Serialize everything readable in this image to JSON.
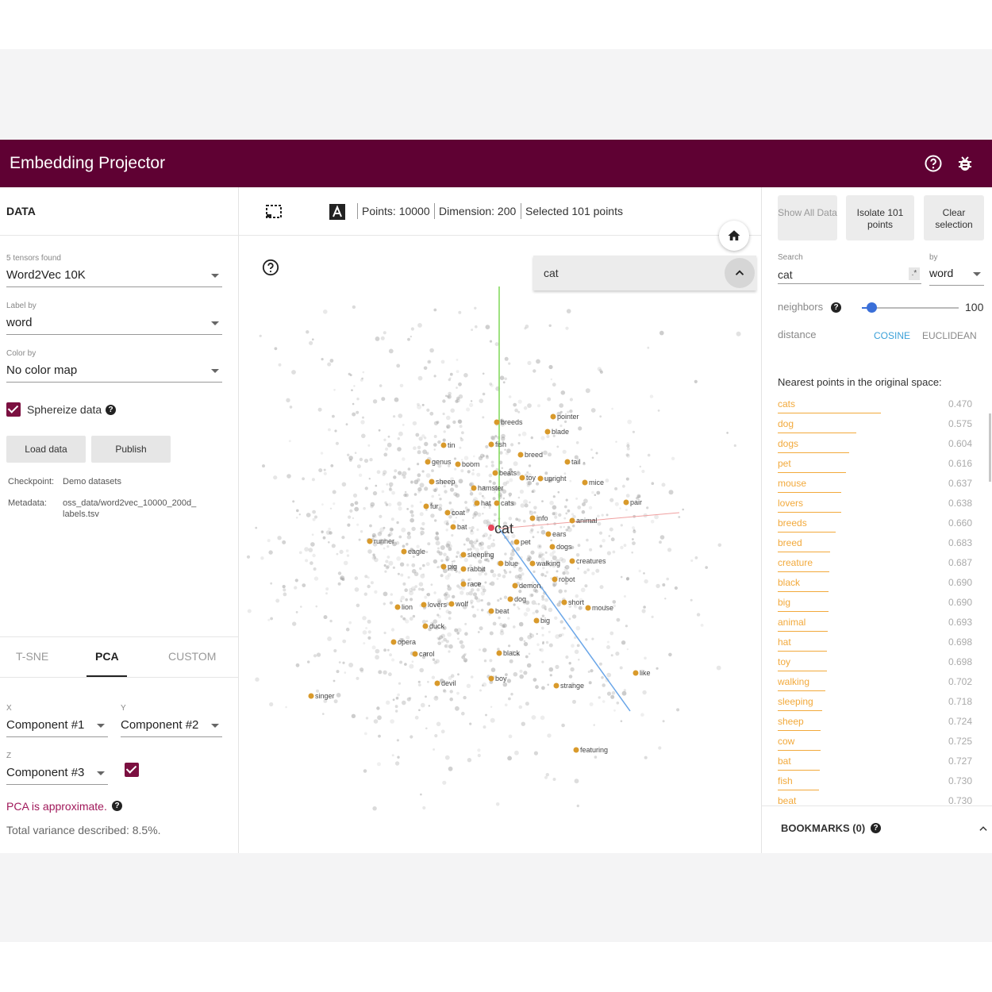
{
  "app": {
    "title": "Embedding Projector"
  },
  "left": {
    "section_title": "DATA",
    "tensors_label": "5 tensors found",
    "tensor_value": "Word2Vec 10K",
    "label_by_label": "Label by",
    "label_by_value": "word",
    "color_by_label": "Color by",
    "color_by_value": "No color map",
    "sphereize_label": "Sphereize data",
    "load_button": "Load data",
    "publish_button": "Publish",
    "checkpoint_key": "Checkpoint:",
    "checkpoint_value": "Demo datasets",
    "metadata_key": "Metadata:",
    "metadata_value_1": "oss_data/word2vec_10000_200d_",
    "metadata_value_2": "labels.tsv",
    "tabs": [
      "T-SNE",
      "PCA",
      "CUSTOM"
    ],
    "x_label": "X",
    "x_value": "Component #1",
    "y_label": "Y",
    "y_value": "Component #2",
    "z_label": "Z",
    "z_value": "Component #3",
    "pca_note": "PCA is approximate.",
    "variance": "Total variance described: 8.5%."
  },
  "center": {
    "points": "Points: 10000",
    "dimension": "Dimension: 200",
    "selected": "Selected 101 points",
    "search_value": "cat",
    "focus_label": "cat",
    "labels": [
      "breeds",
      "pointer",
      "blade",
      "tin",
      "fish",
      "breed",
      "genus",
      "boom",
      "tail",
      "beats",
      "toy",
      "upright",
      "mice",
      "sheep",
      "hamster",
      "fur",
      "hat",
      "cats",
      "pair",
      "coat",
      "info",
      "bat",
      "animal",
      "ears",
      "runner",
      "pet",
      "dogs",
      "eagle",
      "sleeping",
      "creatures",
      "pig",
      "rabbit",
      "blue",
      "walking",
      "robot",
      "race",
      "demon",
      "dog",
      "lion",
      "lovers",
      "wolf",
      "beat",
      "short",
      "mouse",
      "big",
      "duck",
      "opera",
      "carol",
      "black",
      "like",
      "devil",
      "boy",
      "strange",
      "singer",
      "featuring"
    ]
  },
  "right": {
    "show_all": "Show All Data",
    "isolate": "Isolate 101 points",
    "clear": "Clear selection",
    "search_label": "Search",
    "search_value": "cat",
    "by_label": "by",
    "by_value": "word",
    "neighbors_label": "neighbors",
    "neighbors_value": "100",
    "neighbors_fraction": 0.1,
    "distance_label": "distance",
    "cosine": "COSINE",
    "euclidean": "EUCLIDEAN",
    "nearest_title": "Nearest points in the original space:",
    "nearest": [
      {
        "word": "cats",
        "dist": "0.470"
      },
      {
        "word": "dog",
        "dist": "0.575"
      },
      {
        "word": "dogs",
        "dist": "0.604"
      },
      {
        "word": "pet",
        "dist": "0.616"
      },
      {
        "word": "mouse",
        "dist": "0.637"
      },
      {
        "word": "lovers",
        "dist": "0.638"
      },
      {
        "word": "breeds",
        "dist": "0.660"
      },
      {
        "word": "breed",
        "dist": "0.683"
      },
      {
        "word": "creature",
        "dist": "0.687"
      },
      {
        "word": "black",
        "dist": "0.690"
      },
      {
        "word": "big",
        "dist": "0.690"
      },
      {
        "word": "animal",
        "dist": "0.693"
      },
      {
        "word": "hat",
        "dist": "0.698"
      },
      {
        "word": "toy",
        "dist": "0.698"
      },
      {
        "word": "walking",
        "dist": "0.702"
      },
      {
        "word": "sleeping",
        "dist": "0.718"
      },
      {
        "word": "sheep",
        "dist": "0.724"
      },
      {
        "word": "cow",
        "dist": "0.725"
      },
      {
        "word": "bat",
        "dist": "0.727"
      },
      {
        "word": "fish",
        "dist": "0.730"
      },
      {
        "word": "beat",
        "dist": "0.730"
      }
    ],
    "bookmarks": "BOOKMARKS (0)"
  },
  "colors": {
    "brand": "#5f0133",
    "accent": "#7b1040",
    "neighbor": "#f2a93b",
    "link": "#3aa0d8"
  }
}
